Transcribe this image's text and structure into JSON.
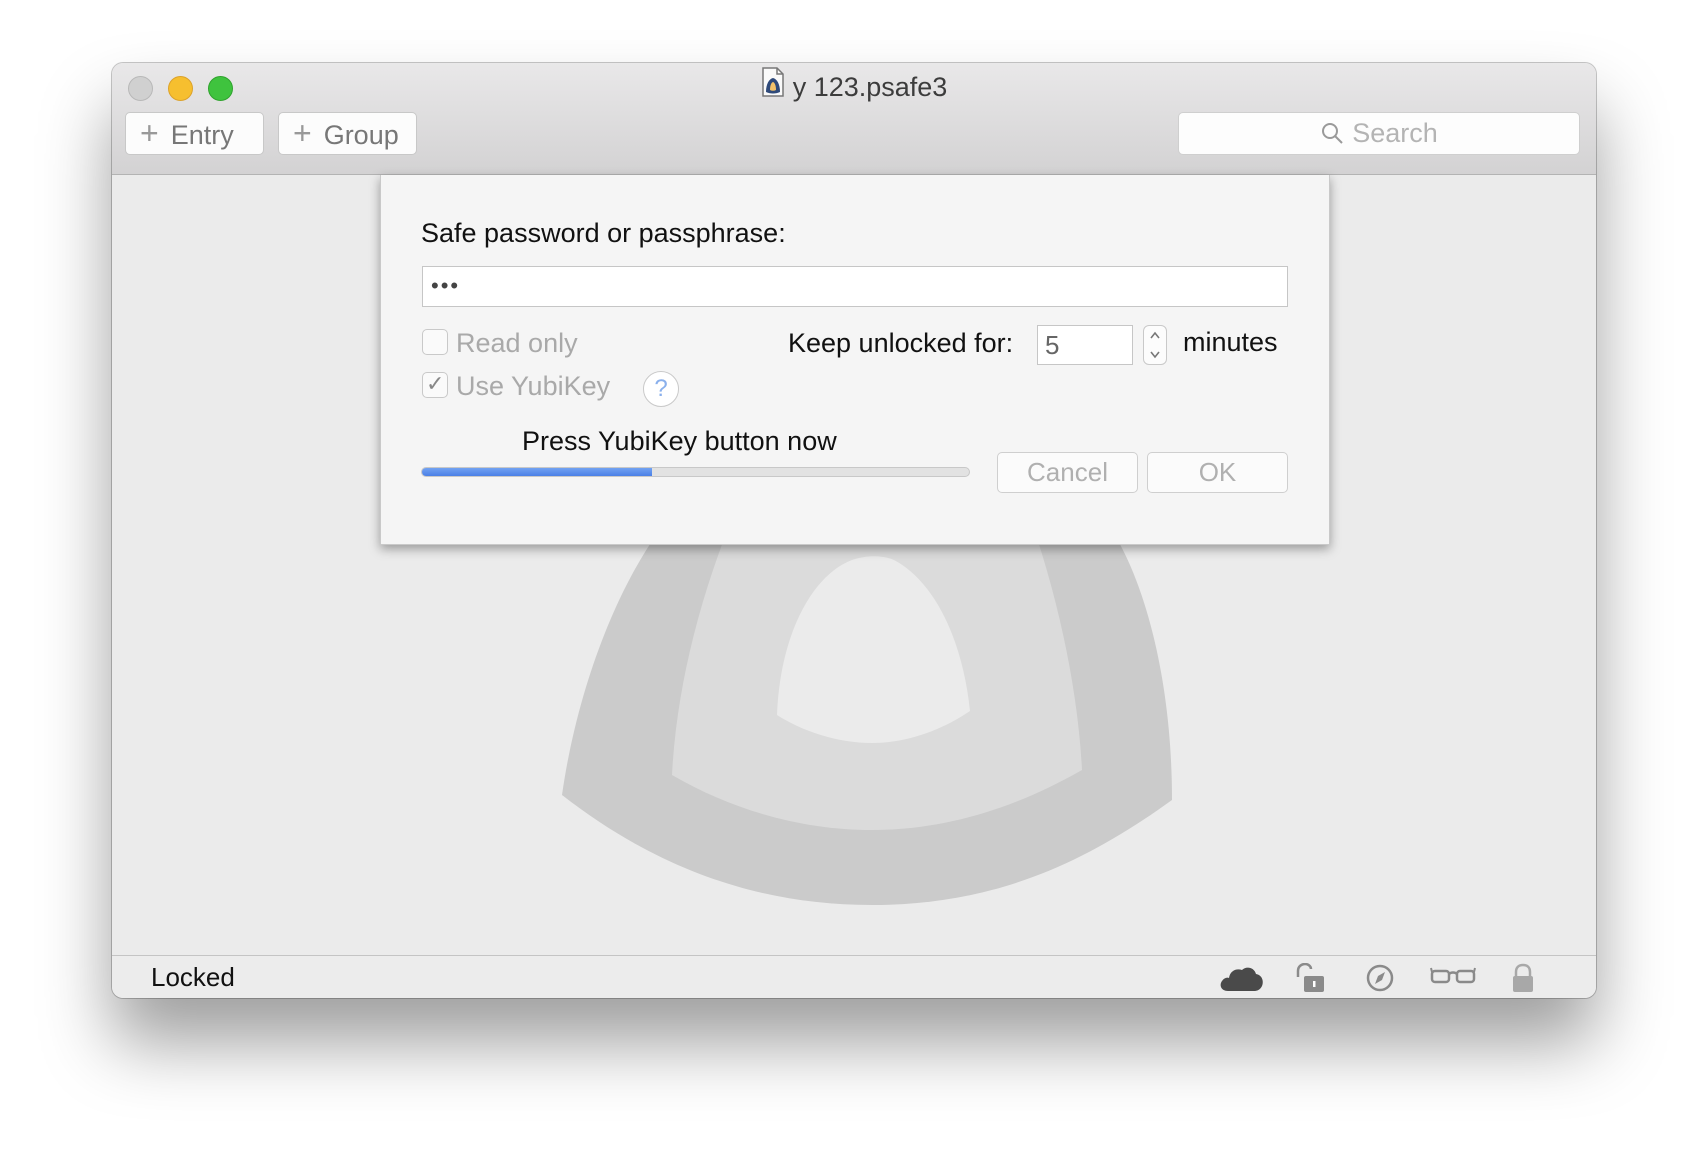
{
  "window": {
    "title": "y 123.psafe3"
  },
  "toolbar": {
    "entry_label": "Entry",
    "group_label": "Group",
    "plus_glyph": "+",
    "search_placeholder": "Search"
  },
  "dialog": {
    "prompt": "Safe password or passphrase:",
    "password_value": "•••",
    "read_only_label": "Read only",
    "read_only_checked": false,
    "use_yubikey_label": "Use YubiKey",
    "use_yubikey_checked": true,
    "help_glyph": "?",
    "keep_unlocked_label": "Keep unlocked for:",
    "keep_unlocked_value": "5",
    "minutes_label": "minutes",
    "progress_label": "Press YubiKey button now",
    "progress_fraction": 0.42,
    "cancel_label": "Cancel",
    "ok_label": "OK"
  },
  "statusbar": {
    "status_text": "Locked",
    "icons": [
      "cloud-icon",
      "unlocked-padlock-icon",
      "compass-icon",
      "glasses-icon",
      "lock-icon"
    ]
  },
  "colors": {
    "accent": "#4b80e6",
    "help": "#8ab0ec",
    "traffic_close": "#d0d0d0",
    "traffic_min": "#f6bf2f",
    "traffic_zoom": "#3fc33e"
  }
}
